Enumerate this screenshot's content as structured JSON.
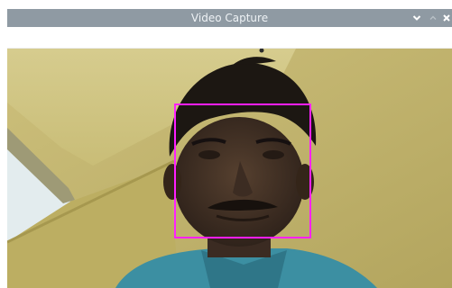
{
  "window": {
    "title": "Video Capture"
  },
  "colors": {
    "titlebar": "#8f9aa3",
    "title_text": "#eef2f5",
    "detection_box": "#ff1fff",
    "wall": "#c2b56d",
    "ceiling": "#d3c889",
    "window_light": "#e3ecee",
    "shirt": "#3c8fa2",
    "hair": "#1c1712",
    "skin": "#4a352a"
  },
  "icons": {
    "minimize": "chevron-down-icon",
    "maximize": "chevron-up-icon",
    "close": "close-icon"
  },
  "detection": {
    "label": ""
  }
}
